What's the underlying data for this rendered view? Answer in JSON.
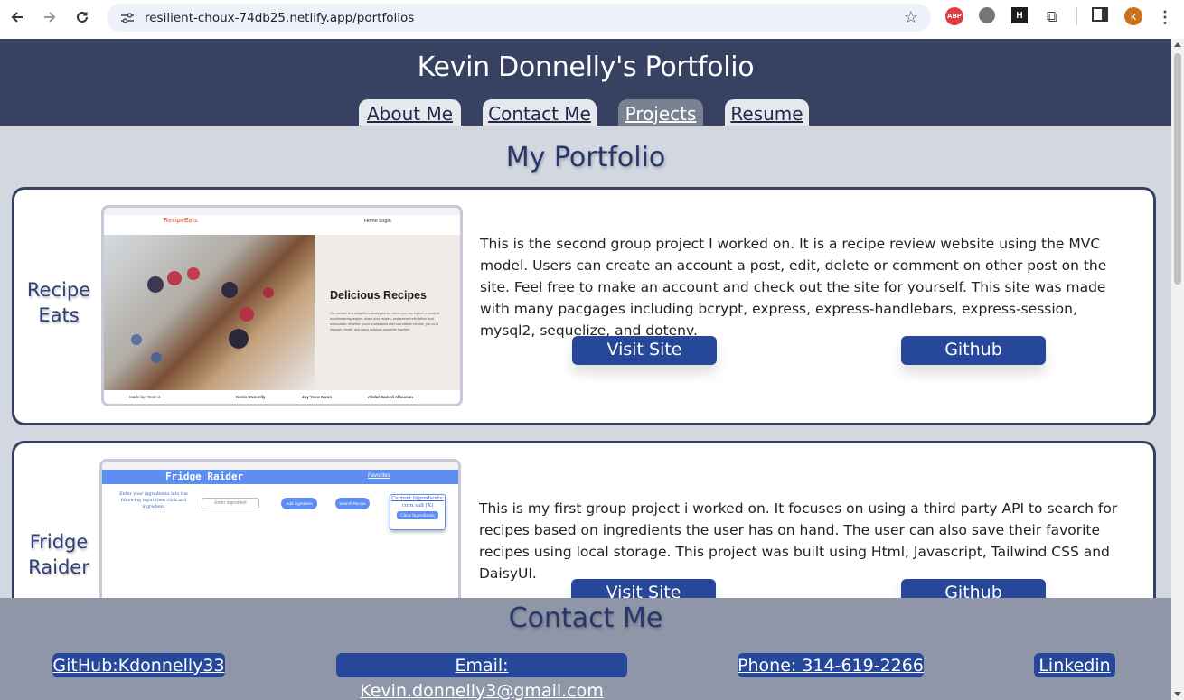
{
  "browser": {
    "url": "resilient-choux-74db25.netlify.app/portfolios",
    "avatar_letter": "k",
    "abp_label": "ABP"
  },
  "header": {
    "title": "Kevin Donnelly's Portfolio",
    "tabs": [
      {
        "label": "About Me",
        "active": false
      },
      {
        "label": "Contact Me",
        "active": false
      },
      {
        "label": "Projects",
        "active": true
      },
      {
        "label": "Resume",
        "active": false
      }
    ]
  },
  "main": {
    "title": "My Portfolio",
    "projects": [
      {
        "name": "Recipe Eats",
        "description": "This is the second group project I worked on. It is a recipe review website using the MVC model. Users can create an account a post, edit, delete or comment on other post on the site. Feel free to make an account and check out the site for yourself. This site was made with many pacgages including bcrypt, express, express-handlebars, express-session, mysql2, sequelize, and dotenv.",
        "visit_label": "Visit Site",
        "github_label": "Github",
        "screenshot": {
          "logo": "RecipeEats",
          "nav": "Home   Login",
          "heading": "Delicious Recipes",
          "blurb": "Our website is a delightful culinary journey where you can explore a world of mouthwatering recipes, share your recipes, and connect with fellow food enthusiasts. Whether you're a seasoned chef or a kitchen newbie, join us to discover, create, and savor delicious moments together.",
          "footer": [
            "Made by: Team 3",
            "Kevin Donnelly",
            "Joy Yoeo Kwon",
            "Abdul Samed Alhassan"
          ]
        }
      },
      {
        "name": "Fridge Raider",
        "description": "This is my first group project i worked on. It focuses on using a third party API to search for recipes based on ingredients the user has on hand. The user can also save their favorite recipes using local storage. This project was built using Html, Javascript, Tailwind CSS and DaisyUI.",
        "visit_label": "Visit Site",
        "github_label": "Github",
        "screenshot": {
          "title": "Fridge Raider",
          "favorites": "Favorites",
          "instructions": "Enter your ingredients into the following input then click add ingredient",
          "input_placeholder": "Enter ingredient",
          "add_button": "Add Ingredient",
          "search_button": "Search Recipe",
          "current_label": "Current Ingredients:",
          "current_value": "corn salt [X]",
          "clear_button": "Clear Ingredients"
        }
      }
    ]
  },
  "footer": {
    "title": "Contact Me",
    "links": [
      {
        "label": "GitHub:Kdonnelly33"
      },
      {
        "label": "Email: Kevin.donnelly3@gmail.com"
      },
      {
        "label": "Phone: 314-619-2266"
      },
      {
        "label": "Linkedin"
      }
    ]
  },
  "colors": {
    "header_bg": "#374262",
    "page_bg": "#d3d7e0",
    "button_bg": "#27479a",
    "title_text": "#27366b",
    "footer_bg": "#8e96a8",
    "active_tab": "#7a8292"
  }
}
